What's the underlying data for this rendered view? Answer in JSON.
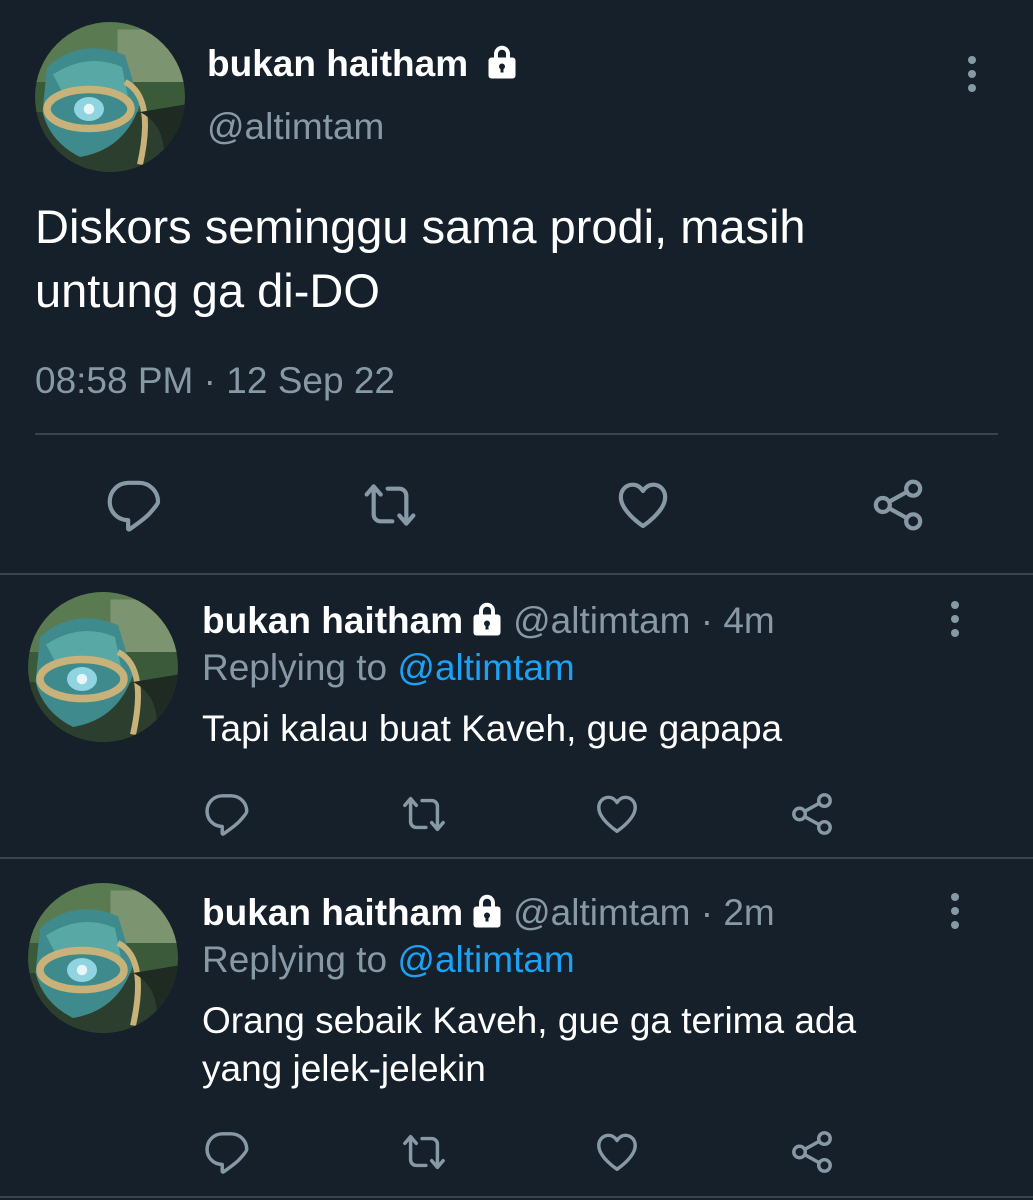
{
  "main_tweet": {
    "display_name": "bukan haitham",
    "handle": "@altimtam",
    "text_line1": "Diskors seminggu sama prodi, masih",
    "text_line2": "untung ga di-DO",
    "time": "08:58 PM",
    "separator": "·",
    "date": "12 Sep 22"
  },
  "replies": [
    {
      "display_name": "bukan haitham",
      "handle": "@altimtam",
      "separator": "·",
      "age": "4m",
      "replying_prefix": "Replying to",
      "replying_to": "@altimtam",
      "text_line1": "Tapi kalau buat Kaveh, gue gapapa",
      "text_line2": ""
    },
    {
      "display_name": "bukan haitham",
      "handle": "@altimtam",
      "separator": "·",
      "age": "2m",
      "replying_prefix": "Replying to",
      "replying_to": "@altimtam",
      "text_line1": "Orang sebaik Kaveh, gue ga terima ada",
      "text_line2": "yang jelek-jelekin"
    }
  ],
  "colors": {
    "background": "#15202b",
    "text": "#ffffff",
    "muted": "#8899a6",
    "link": "#1da1f2",
    "divider": "#38444d"
  },
  "icons": [
    "lock-icon",
    "more-icon",
    "reply-icon",
    "retweet-icon",
    "like-icon",
    "share-icon"
  ]
}
